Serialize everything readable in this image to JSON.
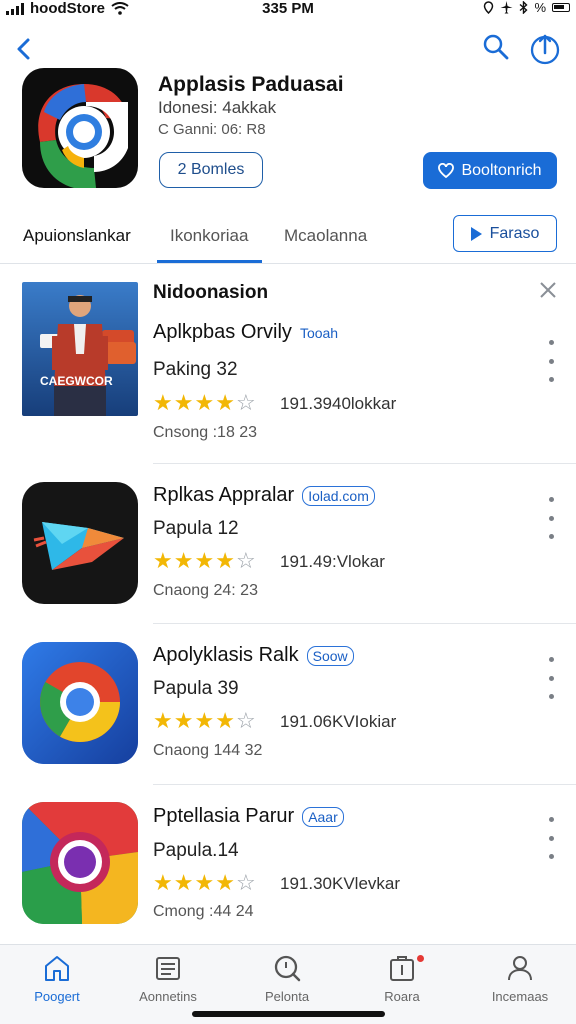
{
  "status_bar": {
    "carrier": "hoodStore",
    "time": "335 PM",
    "battery_text": "%"
  },
  "app": {
    "title": "Applasis Paduasai",
    "developer": "Idonesi: 4akkak",
    "meta": "C Ganni: 06: R8",
    "secondary_button": "2 Bomles",
    "primary_button": "Booltonrich"
  },
  "tabs": [
    {
      "label": "Apuionslankar",
      "active": true
    },
    {
      "label": "Ikonkoriaa",
      "active": false
    },
    {
      "label": "Mcaolanna",
      "active": false
    }
  ],
  "trailer_button": "Faraso",
  "section": {
    "title": "Nidoonasion"
  },
  "items": [
    {
      "name": "Aplkpbas Orvily",
      "badge": "Tooah",
      "subtitle": "Paking 32",
      "stars": 4,
      "rating_count": "191.3940lokkar",
      "date": "Cnsong :18 23",
      "image_caption": "CAEGWCOR"
    },
    {
      "name": "Rplkas Appralar",
      "badge": "Iolad.com",
      "subtitle": "Papula 12",
      "stars": 4,
      "rating_count": "191.49:Vlokar",
      "date": "Cnaong 24: 23"
    },
    {
      "name": "Apolyklasis Ralk",
      "badge": "Soow",
      "subtitle": "Papula 39",
      "stars": 4,
      "rating_count": "191.06KVIokiar",
      "date": "Cnaong 144 32"
    },
    {
      "name": "Pptellasia Parur",
      "badge": "Aaar",
      "subtitle": "Papula.14",
      "stars": 4,
      "rating_count": "191.30KVlevkar",
      "date": "Cmong :44 24"
    }
  ],
  "bottom_tabs": [
    {
      "label": "Poogert",
      "icon": "home-icon",
      "active": true
    },
    {
      "label": "Aonnetins",
      "icon": "news-icon",
      "active": false
    },
    {
      "label": "Pelonta",
      "icon": "search-icon",
      "active": false
    },
    {
      "label": "Roara",
      "icon": "bag-icon",
      "active": false
    },
    {
      "label": "Incemaas",
      "icon": "person-icon",
      "active": false
    }
  ],
  "colors": {
    "accent": "#1a6cd6",
    "star": "#f2b705",
    "notification": "#e53935"
  }
}
